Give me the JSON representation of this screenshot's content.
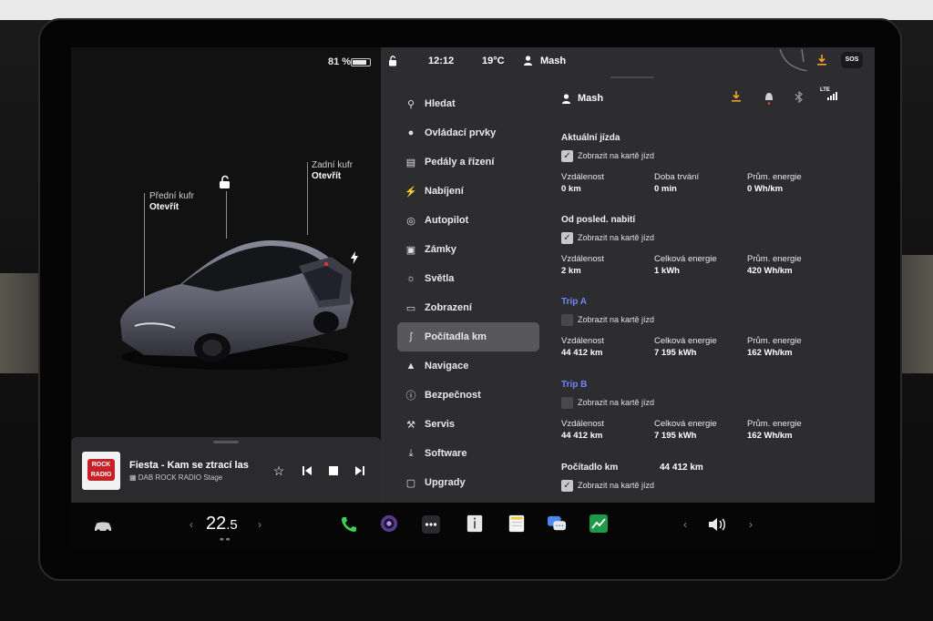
{
  "battery": {
    "percent_label": "81 %",
    "level": 0.81
  },
  "car": {
    "front_trunk_label": "Přední kufr",
    "front_trunk_state": "Otevřít",
    "rear_trunk_label": "Zadní kufr",
    "rear_trunk_state": "Otevřít"
  },
  "media": {
    "album_text_1": "ROCK",
    "album_text_2": "RADIO",
    "track_title": "Fiesta - Kam se ztrací las",
    "station": "DAB ROCK RADIO Stage"
  },
  "status_bar": {
    "time": "12:12",
    "temperature": "19°C",
    "user": "Mash",
    "sos": "SOS"
  },
  "menu": {
    "items": [
      {
        "label": "Hledat",
        "icon": "search-icon"
      },
      {
        "label": "Ovládací prvky",
        "icon": "toggle-icon"
      },
      {
        "label": "Pedály a řízení",
        "icon": "car-icon"
      },
      {
        "label": "Nabíjení",
        "icon": "bolt-icon"
      },
      {
        "label": "Autopilot",
        "icon": "steering-wheel-icon"
      },
      {
        "label": "Zámky",
        "icon": "lock-icon"
      },
      {
        "label": "Světla",
        "icon": "light-icon"
      },
      {
        "label": "Zobrazení",
        "icon": "display-icon"
      },
      {
        "label": "Počítadla km",
        "icon": "odometer-icon",
        "active": true
      },
      {
        "label": "Navigace",
        "icon": "navigation-icon"
      },
      {
        "label": "Bezpečnost",
        "icon": "safety-icon"
      },
      {
        "label": "Servis",
        "icon": "wrench-icon"
      },
      {
        "label": "Software",
        "icon": "download-icon"
      },
      {
        "label": "Upgrady",
        "icon": "bag-icon"
      }
    ]
  },
  "content": {
    "user_name": "Mash",
    "header_icons": [
      "download-icon",
      "bell-icon",
      "bluetooth-icon",
      "lte-signal-icon"
    ],
    "signal_label": "LTE",
    "accent_color": "#6f86ff",
    "current_trip": {
      "title": "Aktuální jízda",
      "show_label": "Zobrazit na kartě jízd",
      "checked": true,
      "stats": [
        {
          "name": "Vzdálenost",
          "value": "0 km"
        },
        {
          "name": "Doba trvání",
          "value": "0 min"
        },
        {
          "name": "Prům. energie",
          "value": "0 Wh/km"
        }
      ]
    },
    "since_charge": {
      "title": "Od posled. nabití",
      "show_label": "Zobrazit na kartě jízd",
      "checked": true,
      "stats": [
        {
          "name": "Vzdálenost",
          "value": "2 km"
        },
        {
          "name": "Celková energie",
          "value": "1 kWh"
        },
        {
          "name": "Prům. energie",
          "value": "420 Wh/km"
        }
      ]
    },
    "trip_a": {
      "title": "Trip A",
      "show_label": "Zobrazit na kartě jízd",
      "checked": false,
      "stats": [
        {
          "name": "Vzdálenost",
          "value": "44 412 km"
        },
        {
          "name": "Celková energie",
          "value": "7 195 kWh"
        },
        {
          "name": "Prům. energie",
          "value": "162 Wh/km"
        }
      ]
    },
    "trip_b": {
      "title": "Trip B",
      "show_label": "Zobrazit na kartě jízd",
      "checked": false,
      "stats": [
        {
          "name": "Vzdálenost",
          "value": "44 412 km"
        },
        {
          "name": "Celková energie",
          "value": "7 195 kWh"
        },
        {
          "name": "Prům. energie",
          "value": "162 Wh/km"
        }
      ]
    },
    "odometer": {
      "label": "Počítadlo km",
      "value": "44 412 km",
      "show_label": "Zobrazit na kartě jízd",
      "checked": true
    }
  },
  "taskbar": {
    "temp_whole": "22",
    "temp_decimal": ".5",
    "icons": [
      "car-icon",
      "phone-icon",
      "camera-icon",
      "more-icon",
      "manual-icon",
      "notes-icon",
      "messages-icon",
      "stocks-icon",
      "volume-icon"
    ]
  }
}
